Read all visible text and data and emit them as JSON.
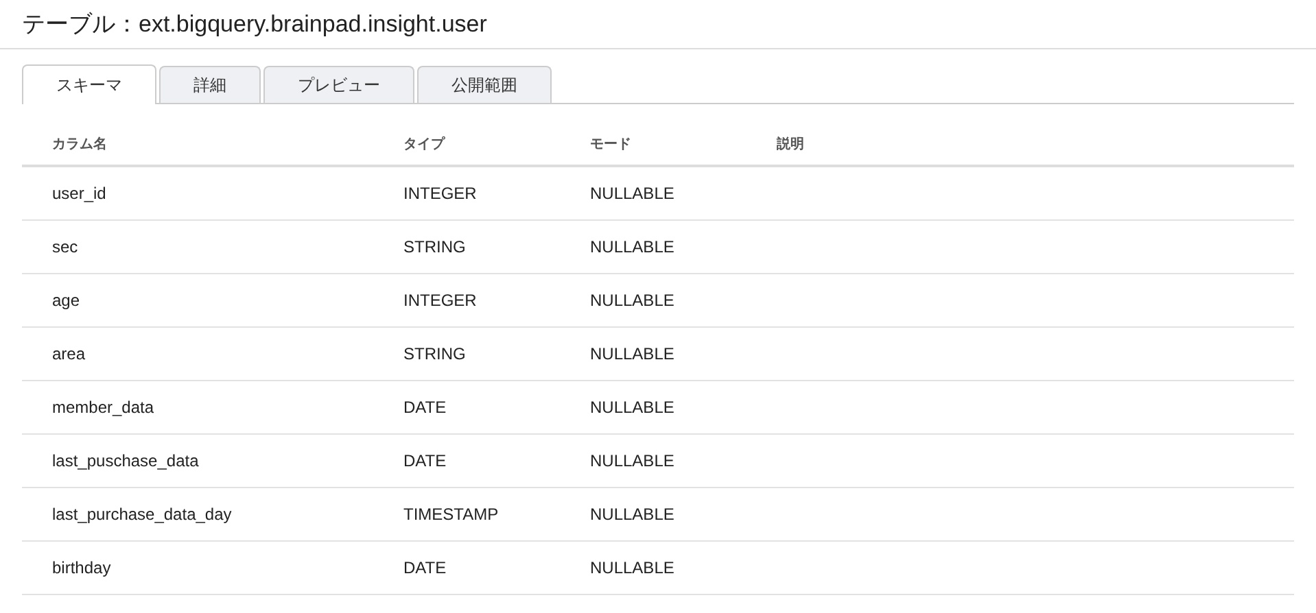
{
  "title": "テーブル：ext.bigquery.brainpad.insight.user",
  "tabs": [
    {
      "label": "スキーマ",
      "selected": true
    },
    {
      "label": "詳細",
      "selected": false
    },
    {
      "label": "プレビュー",
      "selected": false
    },
    {
      "label": "公開範囲",
      "selected": false
    }
  ],
  "table": {
    "columns": [
      "カラム名",
      "タイプ",
      "モード",
      "説明"
    ],
    "rows": [
      [
        "user_id",
        "INTEGER",
        "NULLABLE"
      ],
      [
        "sec",
        "STRING",
        "NULLABLE"
      ],
      [
        "age",
        "INTEGER",
        "NULLABLE"
      ],
      [
        "area",
        "STRING",
        "NULLABLE"
      ],
      [
        "member_data",
        "DATE",
        "NULLABLE"
      ],
      [
        "last_puschase_data",
        "DATE",
        "NULLABLE"
      ],
      [
        "last_purchase_data_day",
        "TIMESTAMP",
        "NULLABLE"
      ],
      [
        "birthday",
        "DATE",
        "NULLABLE"
      ]
    ]
  }
}
